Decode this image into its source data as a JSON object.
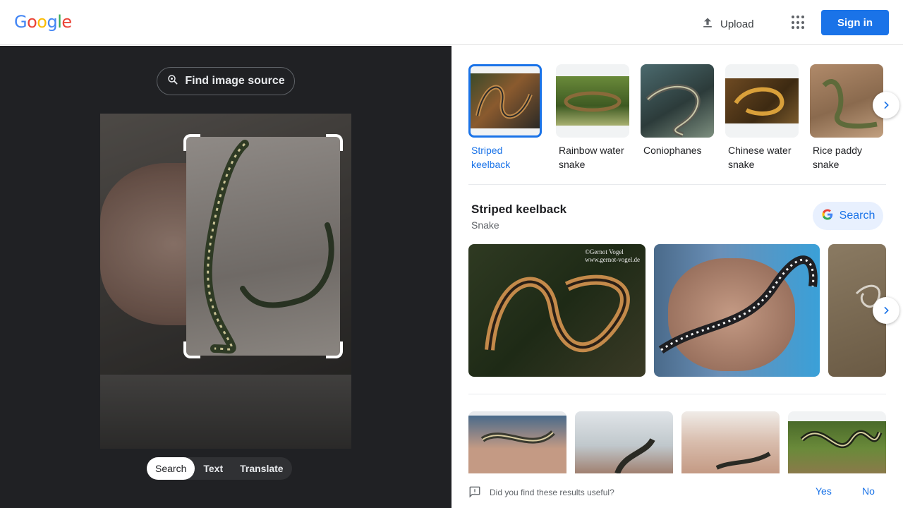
{
  "header": {
    "logo_letters": [
      {
        "ch": "G",
        "color": "#4285F4"
      },
      {
        "ch": "o",
        "color": "#EA4335"
      },
      {
        "ch": "o",
        "color": "#FBBC05"
      },
      {
        "ch": "g",
        "color": "#4285F4"
      },
      {
        "ch": "l",
        "color": "#34A853"
      },
      {
        "ch": "e",
        "color": "#EA4335"
      }
    ],
    "upload_label": "Upload",
    "apps_icon": "apps-grid-icon",
    "signin_label": "Sign in"
  },
  "left": {
    "find_source_label": "Find image source",
    "modes": [
      "Search",
      "Text",
      "Translate"
    ],
    "active_mode": "Search"
  },
  "right": {
    "chips": [
      {
        "label": "Striped keelback",
        "selected": true
      },
      {
        "label": "Rainbow water snake",
        "selected": false
      },
      {
        "label": "Coniophanes",
        "selected": false
      },
      {
        "label": "Chinese water snake",
        "selected": false
      },
      {
        "label": "Rice paddy snake",
        "selected": false
      }
    ],
    "entity": {
      "title": "Striped keelback",
      "subtitle": "Snake",
      "search_label": "Search"
    },
    "watermark": "©Gernot Vogel\nwww.gernot-vogel.de",
    "feedback": {
      "question": "Did you find these results useful?",
      "yes": "Yes",
      "no": "No"
    }
  },
  "colors": {
    "accent": "#1a73e8",
    "left_bg": "#202124"
  }
}
